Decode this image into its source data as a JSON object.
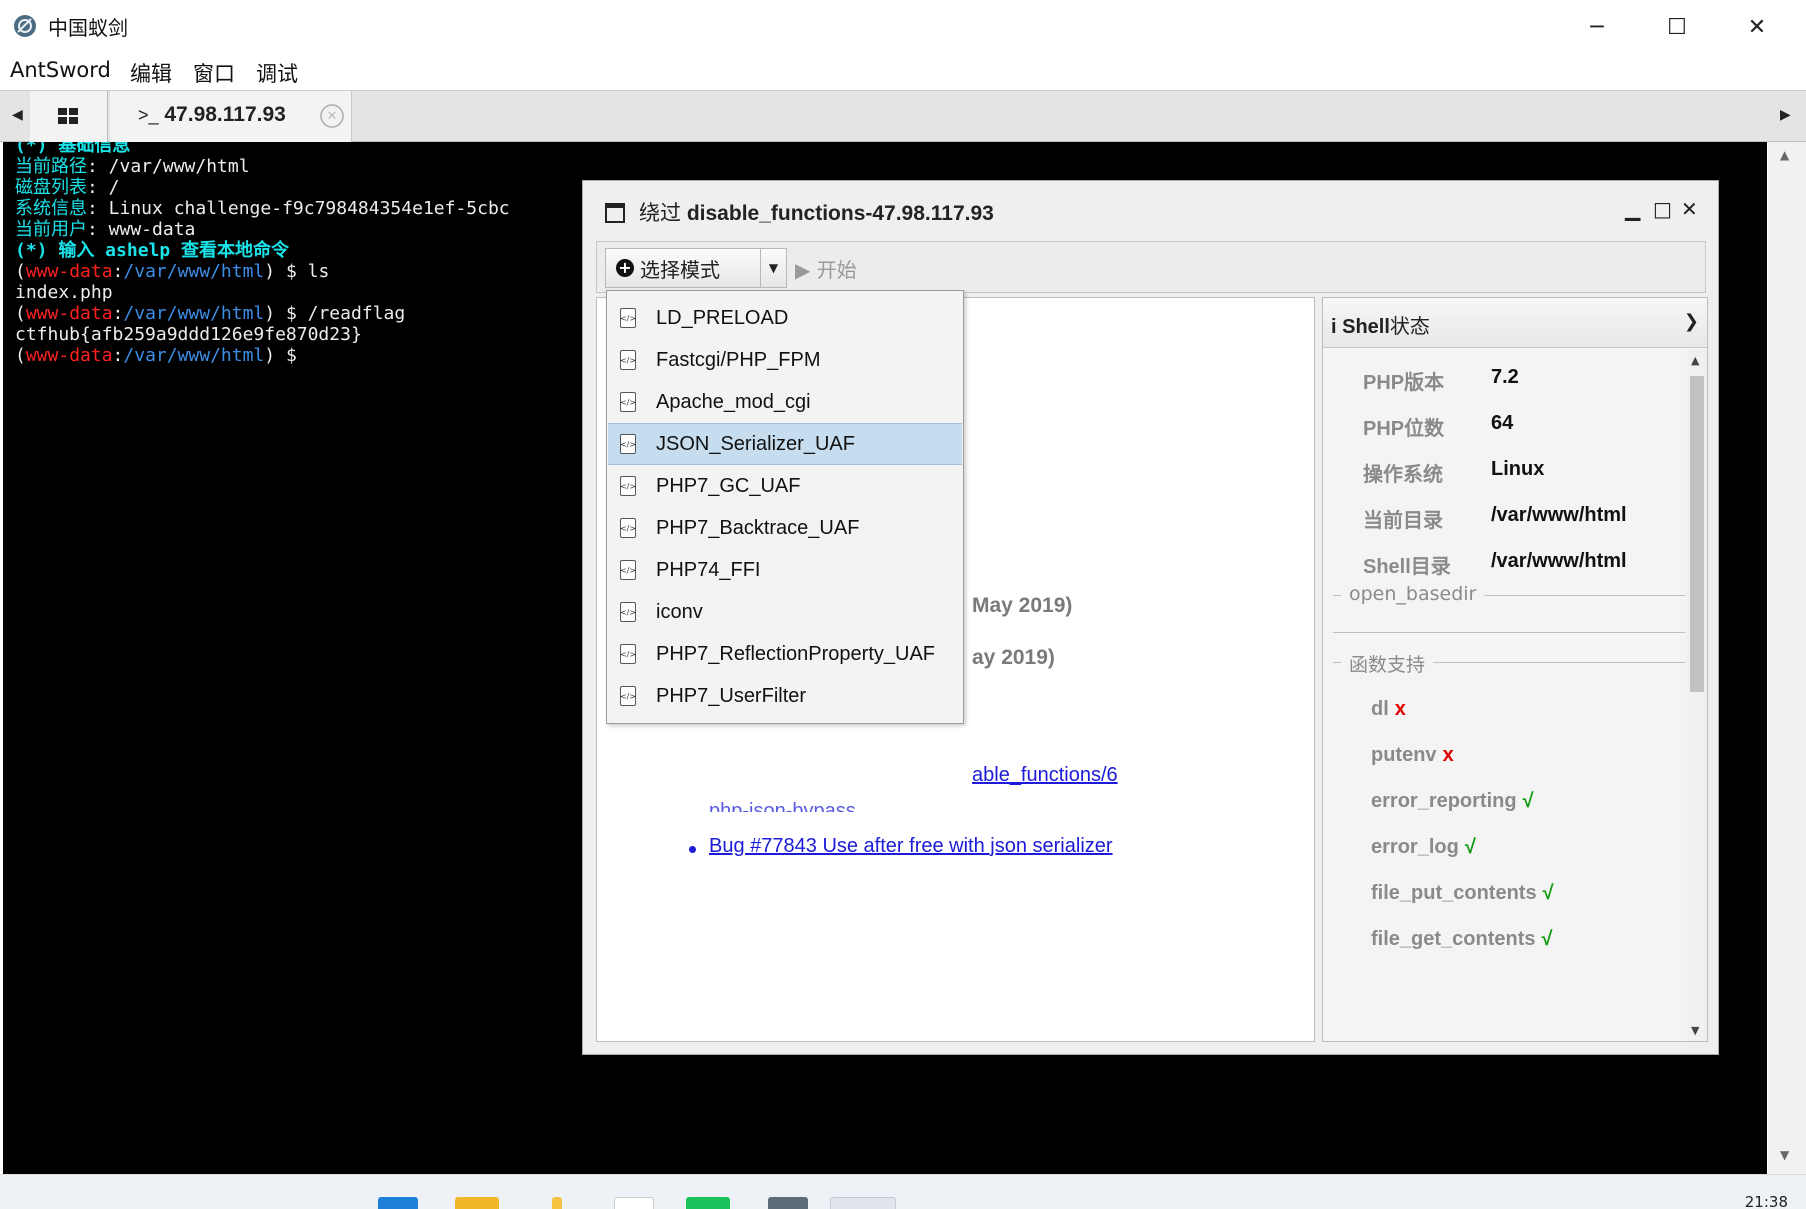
{
  "app": {
    "title": "中国蚁剑",
    "window_controls": {
      "minimize": "─",
      "maximize": "☐",
      "close": "✕"
    }
  },
  "menu": [
    "AntSword",
    "编辑",
    "窗口",
    "调试"
  ],
  "tabs": {
    "shell_tab_prompt": ">_",
    "shell_tab_label": "47.98.117.93"
  },
  "terminal": {
    "lines": [
      {
        "parts": [
          {
            "t": "(*) 基础信息",
            "c": "cyan"
          }
        ]
      },
      {
        "parts": [
          {
            "t": "当前路径",
            "c": "cyan-n"
          },
          {
            "t": ": /var/www/html",
            "c": ""
          }
        ]
      },
      {
        "parts": [
          {
            "t": "磁盘列表",
            "c": "cyan-n"
          },
          {
            "t": ": /",
            "c": ""
          }
        ]
      },
      {
        "parts": [
          {
            "t": "系统信息",
            "c": "cyan-n"
          },
          {
            "t": ": Linux challenge-f9c798484354e1ef-5cbc",
            "c": ""
          }
        ]
      },
      {
        "parts": [
          {
            "t": "当前用户",
            "c": "cyan-n"
          },
          {
            "t": ": www-data",
            "c": ""
          }
        ]
      },
      {
        "parts": [
          {
            "t": "(*) 输入 ashelp 查看本地命令",
            "c": "cyan"
          }
        ]
      },
      {
        "parts": [
          {
            "t": "(",
            "c": ""
          },
          {
            "t": "www-data",
            "c": "red"
          },
          {
            "t": ":",
            "c": ""
          },
          {
            "t": "/var/www/html",
            "c": "blue"
          },
          {
            "t": ") $ ls",
            "c": ""
          }
        ]
      },
      {
        "parts": [
          {
            "t": "index.php",
            "c": ""
          }
        ]
      },
      {
        "parts": [
          {
            "t": "(",
            "c": ""
          },
          {
            "t": "www-data",
            "c": "red"
          },
          {
            "t": ":",
            "c": ""
          },
          {
            "t": "/var/www/html",
            "c": "blue"
          },
          {
            "t": ") $ /readflag",
            "c": ""
          }
        ]
      },
      {
        "parts": [
          {
            "t": "ctfhub{afb259a9ddd126e9fe870d23}",
            "c": ""
          }
        ]
      },
      {
        "parts": [
          {
            "t": "(",
            "c": ""
          },
          {
            "t": "www-data",
            "c": "red"
          },
          {
            "t": ":",
            "c": ""
          },
          {
            "t": "/var/www/html",
            "c": "blue"
          },
          {
            "t": ") $",
            "c": ""
          }
        ]
      }
    ]
  },
  "dialog": {
    "title_prefix": "绕过",
    "title_main": "disable_functions-47.98.117.93",
    "controls": {
      "minimize": "▁",
      "maximize": "□",
      "close": "✕"
    },
    "toolbar": {
      "mode_label": "选择模式",
      "start_label": "▶ 开始"
    },
    "content": {
      "partial_1": "May 2019)",
      "partial_2": "ay 2019)",
      "link_partial": "able_functions/6",
      "link_hidden": "php-json-bypass",
      "link_bug": "Bug #77843 Use after free with json serializer"
    },
    "dropdown": {
      "items": [
        "LD_PRELOAD",
        "Fastcgi/PHP_FPM",
        "Apache_mod_cgi",
        "JSON_Serializer_UAF",
        "PHP7_GC_UAF",
        "PHP7_Backtrace_UAF",
        "PHP74_FFI",
        "iconv",
        "PHP7_ReflectionProperty_UAF",
        "PHP7_UserFilter"
      ],
      "selected": "JSON_Serializer_UAF"
    },
    "shell_panel": {
      "title_icon": "i",
      "title_bold": "Shell",
      "title_rest": "状态",
      "info": [
        {
          "key": "PHP版本",
          "value": "7.2"
        },
        {
          "key": "PHP位数",
          "value": "64"
        },
        {
          "key": "操作系统",
          "value": "Linux"
        },
        {
          "key": "当前目录",
          "value": "/var/www/html"
        },
        {
          "key": "Shell目录",
          "value": "/var/www/html"
        }
      ],
      "open_basedir_legend": "open_basedir",
      "functions_legend": "函数支持",
      "functions": [
        {
          "name": "dl",
          "status": "x"
        },
        {
          "name": "putenv",
          "status": "x"
        },
        {
          "name": "error_reporting",
          "status": "√"
        },
        {
          "name": "error_log",
          "status": "√"
        },
        {
          "name": "file_put_contents",
          "status": "√"
        },
        {
          "name": "file_get_contents",
          "status": "√"
        }
      ]
    }
  },
  "taskbar": {
    "clock": "21:38"
  },
  "colors": {
    "terminal_bg": "#000000",
    "accent_cyan": "#19e2e8",
    "prompt_user_red": "#ff2020",
    "path_blue": "#3c8ee6",
    "link_blue": "#1b1bd9",
    "selected_bg": "#c6ddf0",
    "ok_green": "#109a10",
    "bad_red": "#e00000"
  }
}
